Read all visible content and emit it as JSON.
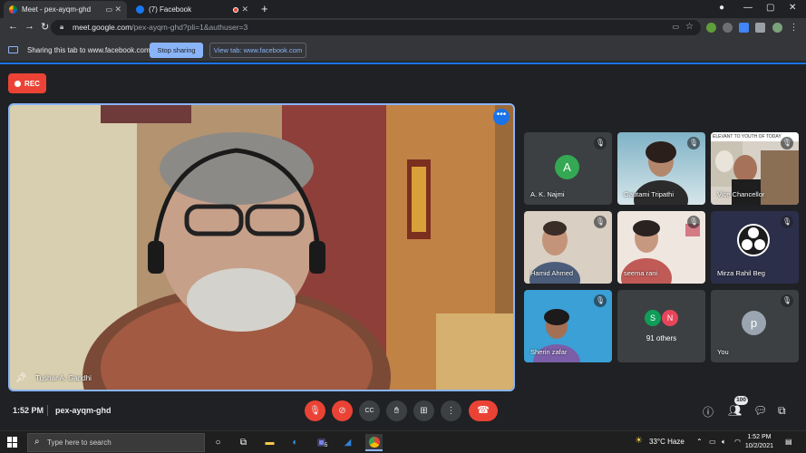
{
  "browser": {
    "tabs": [
      {
        "title": "Meet - pex-ayqm-ghd",
        "active": true
      },
      {
        "title": "(7) Facebook",
        "active": false
      }
    ],
    "url_host": "meet.google.com",
    "url_path": "/pex-ayqm-ghd?pli=1&authuser=3"
  },
  "share_bar": {
    "message": "Sharing this tab to www.facebook.com",
    "stop_label": "Stop sharing",
    "view_label": "View tab: www.facebook.com"
  },
  "meet": {
    "rec_label": "REC",
    "main_speaker": "Tushar A. Gandhi",
    "participants": [
      {
        "name": "A. K. Najmi",
        "initial": "A",
        "color": "#34a853"
      },
      {
        "name": "Gautami Tripathi"
      },
      {
        "name": "Vice Chancellor",
        "banner": "ELEVANT TO YOUTH OF TODAY"
      },
      {
        "name": "Hamid Ahmed"
      },
      {
        "name": "seema rani"
      },
      {
        "name": "Mirza Rahil Beg"
      },
      {
        "name": "Sherin zafar"
      },
      {
        "name": "91 others",
        "initials": [
          "S",
          "N"
        ]
      },
      {
        "name": "You",
        "initial": "p"
      }
    ],
    "time": "1:52 PM",
    "meeting_code": "pex-ayqm-ghd",
    "people_count": "100"
  },
  "taskbar": {
    "search_placeholder": "Type here to search",
    "weather": "33°C  Haze",
    "clock_time": "1:52 PM",
    "clock_date": "10/2/2021",
    "notif_count": "5"
  }
}
